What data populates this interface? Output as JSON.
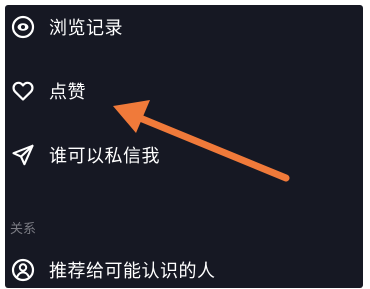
{
  "menu": {
    "items": [
      {
        "label": "浏览记录",
        "icon": "eye-icon"
      },
      {
        "label": "点赞",
        "icon": "heart-icon"
      },
      {
        "label": "谁可以私信我",
        "icon": "paper-plane-icon"
      }
    ]
  },
  "relations": {
    "header": "关系",
    "items": [
      {
        "label": "推荐给可能认识的人",
        "icon": "person-circle-icon"
      }
    ]
  },
  "colors": {
    "panel_background": "#161823",
    "text": "#ffffff",
    "section_header": "#7a7b83",
    "annotation_arrow": "#f07a3a"
  }
}
